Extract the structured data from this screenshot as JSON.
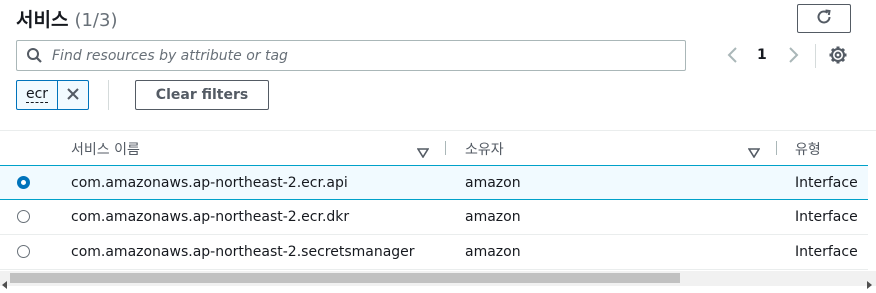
{
  "header": {
    "title": "서비스",
    "count": "(1/3)"
  },
  "search": {
    "placeholder": "Find resources by attribute or tag",
    "value": ""
  },
  "pagination": {
    "current_page": "1"
  },
  "filters": {
    "tokens": [
      {
        "label": "ecr"
      }
    ],
    "clear_label": "Clear filters"
  },
  "table": {
    "columns": [
      "서비스 이름",
      "소유자",
      "유형"
    ],
    "rows": [
      {
        "service_name": "com.amazonaws.ap-northeast-2.ecr.api",
        "owner": "amazon",
        "type": "Interface",
        "selected": true
      },
      {
        "service_name": "com.amazonaws.ap-northeast-2.ecr.dkr",
        "owner": "amazon",
        "type": "Interface",
        "selected": false
      },
      {
        "service_name": "com.amazonaws.ap-northeast-2.secretsmanager",
        "owner": "amazon",
        "type": "Interface",
        "selected": false
      }
    ]
  },
  "icons": {
    "refresh": "refresh-icon",
    "search": "search-icon",
    "prev": "chevron-left-icon",
    "next": "chevron-right-icon",
    "settings": "gear-icon",
    "dismiss": "close-icon",
    "sort": "caret-down-icon"
  },
  "colors": {
    "accent": "#0073bb",
    "selected_row_bg": "#f1faff",
    "selected_row_border": "#00a1c9"
  }
}
